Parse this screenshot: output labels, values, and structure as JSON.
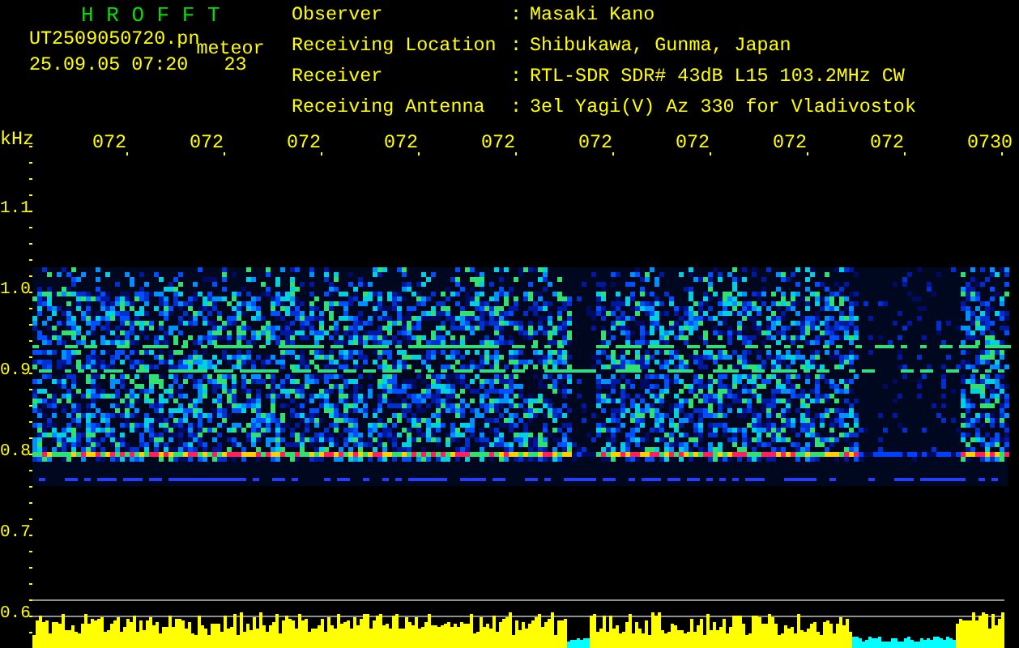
{
  "title": "H R O F F T",
  "file_name": "UT2509050720.pn",
  "mode": "meteor",
  "timestamp": "25.09.05 07:20",
  "count": "23",
  "info": [
    {
      "label": "Observer",
      "separator": ":",
      "value": "Masaki Kano"
    },
    {
      "label": "Receiving Location",
      "separator": ":",
      "value": "Shibukawa, Gunma, Japan"
    },
    {
      "label": "Receiver",
      "separator": ":",
      "value": "RTL-SDR SDR# 43dB L15 103.2MHz CW"
    },
    {
      "label": "Receiving Antenna",
      "separator": ":",
      "value": "3el Yagi(V) Az 330 for Vladivostok"
    }
  ],
  "time_axis": {
    "labels": [
      "072",
      "072",
      "072",
      "072",
      "072",
      "072",
      "072",
      "072",
      "072",
      "0730"
    ]
  },
  "frequency_axis": {
    "unit": "kHz",
    "labels": [
      "1.1",
      "1.0",
      "0.9",
      "0.8",
      "0.7",
      "0.6"
    ]
  }
}
